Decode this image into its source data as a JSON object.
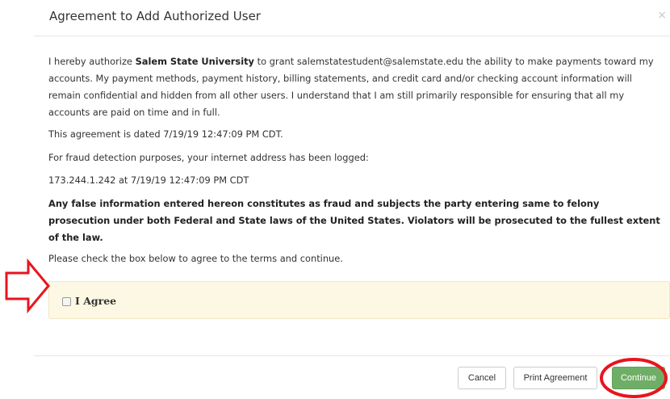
{
  "modal": {
    "title": "Agreement to Add Authorized User",
    "close_symbol": "×"
  },
  "body": {
    "p1_prefix": "I hereby authorize ",
    "p1_institution": "Salem State University",
    "p1_rest": " to grant salemstatestudent@salemstate.edu the ability to make payments toward my accounts. My payment methods, payment history, billing statements, and credit card and/or checking account information will remain confidential and hidden from all other users. I understand that I am still primarily responsible for ensuring that all my accounts are paid on time and in full.",
    "dated": "This agreement is dated 7/19/19 12:47:09 PM CDT.",
    "fraud_notice": "For fraud detection purposes, your internet address has been logged:",
    "ip_log": "173.244.1.242 at 7/19/19 12:47:09 PM CDT",
    "warning": "Any false information entered hereon constitutes as fraud and subjects the party entering same to felony prosecution under both Federal and State laws of the United States. Violators will be prosecuted to the fullest extent of the law.",
    "instruction": "Please check the box below to agree to the terms and continue."
  },
  "agree": {
    "label": "I Agree",
    "checked": false
  },
  "footer": {
    "cancel_label": "Cancel",
    "print_label": "Print Agreement",
    "continue_label": "Continue"
  },
  "colors": {
    "agree_bg": "#fcf8e3",
    "continue_bg": "#6fae66",
    "annotation_red": "#e8141e"
  },
  "annotations": {
    "arrow_icon": "red-arrow-icon",
    "circle_icon": "red-circle-icon"
  }
}
